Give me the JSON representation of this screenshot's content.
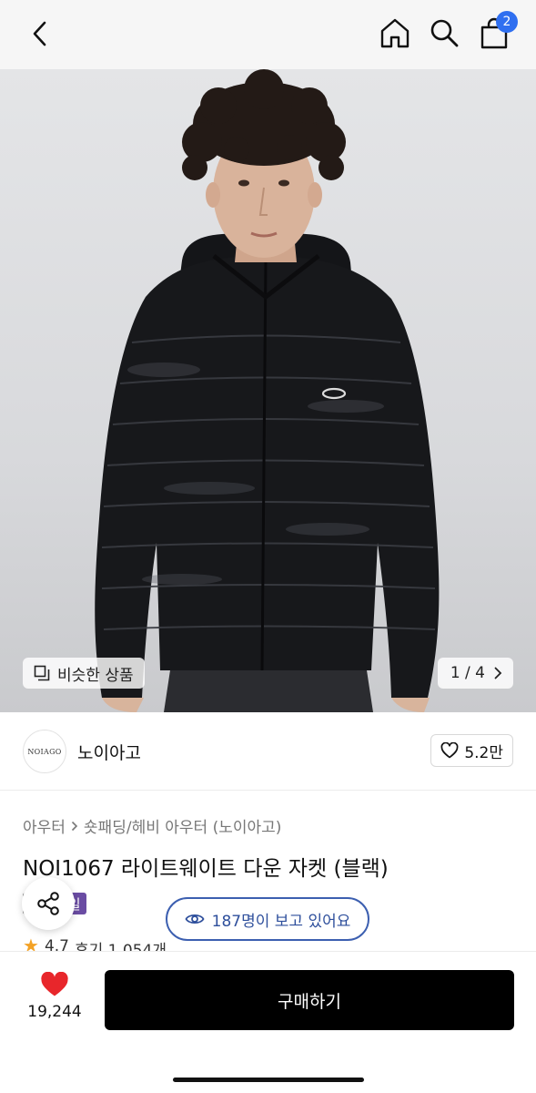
{
  "header": {
    "back_icon": "chevron-left-icon",
    "home_icon": "home-icon",
    "search_icon": "search-icon",
    "bag_icon": "shopping-bag-icon",
    "cart_count": "2"
  },
  "gallery": {
    "similar_label": "비슷한 상품",
    "page_indicator": "1 / 4",
    "current_index": 1,
    "total": 4
  },
  "store": {
    "logo_text": "NOIAGO",
    "name": "노이아고",
    "like_count": "5.2만"
  },
  "product": {
    "breadcrumb": [
      "아우터",
      "숏패딩/헤비 아우터 (노이아고)"
    ],
    "title": "NOI1067 라이트웨이트 다운 자켓 (블랙)",
    "tag_sale": "세일",
    "viewers_text": "187명이 보고 있어요",
    "rating": "4.7",
    "reviews": "후기 1,054개"
  },
  "footer": {
    "wish_count": "19,244",
    "buy_label": "구매하기"
  },
  "colors": {
    "accent_blue": "#2f6ff0",
    "viewer_blue": "#3c5fb0",
    "tag_purple": "#6a4ca3",
    "heart_red": "#e8262b",
    "star_orange": "#f3a226"
  }
}
